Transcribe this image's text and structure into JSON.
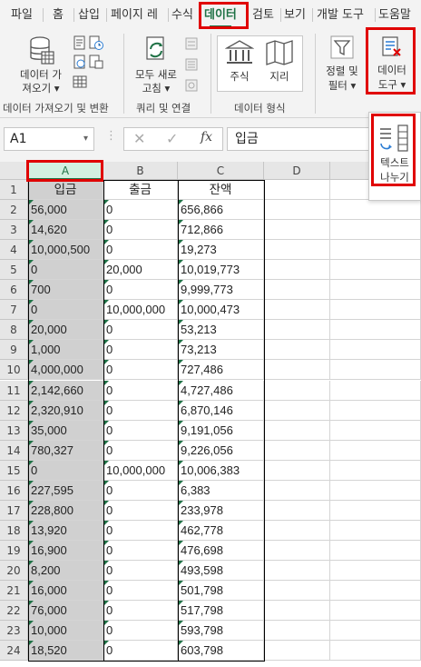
{
  "tabs": [
    "파일",
    "홈",
    "삽입",
    "페이지 레",
    "수식",
    "데이터",
    "검토",
    "보기",
    "개발 도구",
    "도움말"
  ],
  "ribbon": {
    "get_data_label1": "데이터 가",
    "get_data_label2": "져오기",
    "refresh_label1": "모두 새로",
    "refresh_label2": "고침",
    "stocks_label": "주식",
    "geo_label": "지리",
    "sort_label1": "정렬 및",
    "sort_label2": "필터",
    "tools_label1": "데이터",
    "tools_label2": "도구",
    "group_get": "데이터 가져오기 및 변환",
    "group_query": "쿼리 및 연결",
    "group_types": "데이터 형식"
  },
  "dropdown": {
    "text_to_col1": "텍스트",
    "text_to_col2": "나누기"
  },
  "formula_bar": {
    "cell_ref": "A1",
    "fx": "fx",
    "content": "입금"
  },
  "columns": [
    "A",
    "B",
    "C",
    "D",
    "E"
  ],
  "headers": [
    "입금",
    "출금",
    "잔액"
  ],
  "rows": [
    [
      "56,000",
      "0",
      "656,866"
    ],
    [
      "14,620",
      "0",
      "712,866"
    ],
    [
      "10,000,500",
      "0",
      "19,273"
    ],
    [
      "0",
      "20,000",
      "10,019,773"
    ],
    [
      "700",
      "0",
      "9,999,773"
    ],
    [
      "0",
      "10,000,000",
      "10,000,473"
    ],
    [
      "20,000",
      "0",
      "53,213"
    ],
    [
      "1,000",
      "0",
      "73,213"
    ],
    [
      "4,000,000",
      "0",
      "727,486"
    ],
    [
      "2,142,660",
      "0",
      "4,727,486"
    ],
    [
      "2,320,910",
      "0",
      "6,870,146"
    ],
    [
      "35,000",
      "0",
      "9,191,056"
    ],
    [
      "780,327",
      "0",
      "9,226,056"
    ],
    [
      "0",
      "10,000,000",
      "10,006,383"
    ],
    [
      "227,595",
      "0",
      "6,383"
    ],
    [
      "228,800",
      "0",
      "233,978"
    ],
    [
      "13,920",
      "0",
      "462,778"
    ],
    [
      "16,900",
      "0",
      "476,698"
    ],
    [
      "8,200",
      "0",
      "493,598"
    ],
    [
      "16,000",
      "0",
      "501,798"
    ],
    [
      "76,000",
      "0",
      "517,798"
    ],
    [
      "10,000",
      "0",
      "593,798"
    ],
    [
      "18,520",
      "0",
      "603,798"
    ]
  ],
  "colors": {
    "excel_green": "#217346",
    "highlight_red": "#e00000",
    "selected_fill": "#d0d0d0"
  }
}
